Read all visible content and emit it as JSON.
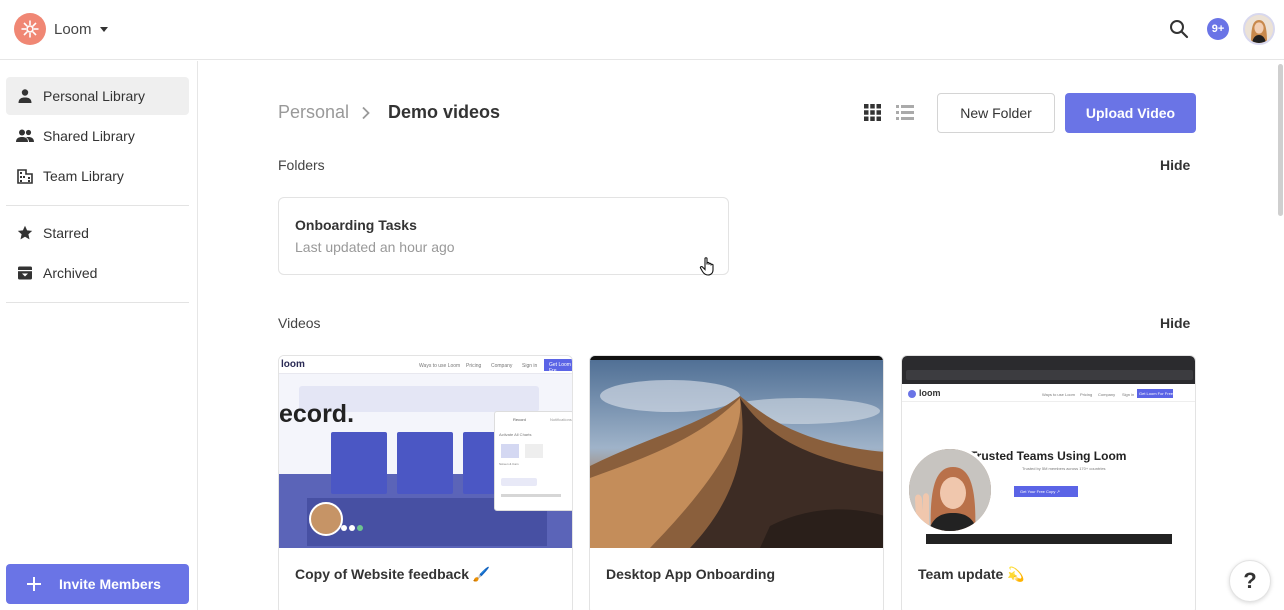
{
  "header": {
    "workspace_name": "Loom",
    "notification_count": "9+",
    "icons": {
      "logo": "loom-logo-icon",
      "caret": "caret-down-icon",
      "search": "search-icon",
      "avatar": "user-avatar"
    }
  },
  "sidebar": {
    "items": [
      {
        "label": "Personal Library",
        "icon": "person-icon",
        "active": true
      },
      {
        "label": "Shared Library",
        "icon": "people-icon",
        "active": false
      },
      {
        "label": "Team Library",
        "icon": "building-icon",
        "active": false
      },
      {
        "label": "Starred",
        "icon": "star-icon",
        "active": false
      },
      {
        "label": "Archived",
        "icon": "archive-icon",
        "active": false
      }
    ],
    "invite_label": "Invite Members"
  },
  "main": {
    "breadcrumb": {
      "root": "Personal",
      "current": "Demo videos"
    },
    "new_folder_label": "New Folder",
    "upload_label": "Upload Video",
    "view_mode": "grid",
    "folders_section": {
      "label": "Folders",
      "hide_label": "Hide"
    },
    "folders": [
      {
        "title": "Onboarding Tasks",
        "subtitle": "Last updated an hour ago"
      }
    ],
    "videos_section": {
      "label": "Videos",
      "hide_label": "Hide"
    },
    "videos": [
      {
        "title": "Copy of Website feedback 🖌️",
        "thumb": {
          "logo": "loom",
          "nav": [
            "Ways to use Loom",
            "Pricing",
            "Company",
            "Sign in"
          ],
          "cta": "Get Loom Fre",
          "headline": "ecord.",
          "panel_tabs": [
            "Record",
            "Notifications"
          ],
          "panel_label": "Activate All Charts",
          "panel_caption": "Screen & Cam"
        }
      },
      {
        "title": "Desktop App Onboarding"
      },
      {
        "title": "Team update 💫",
        "thumb": {
          "logo": "loom",
          "nav": [
            "Ways to use Loom",
            "Pricing",
            "Company",
            "Sign in"
          ],
          "cta": "Get Loom For Free",
          "headline": "Trusted Teams Using Loom",
          "subline": "Trusted by 5M members across 170+ countries",
          "button": "Get Your Free Copy ↗"
        }
      }
    ]
  },
  "help_label": "?",
  "colors": {
    "accent": "#6a74e6",
    "logo": "#f08774"
  }
}
